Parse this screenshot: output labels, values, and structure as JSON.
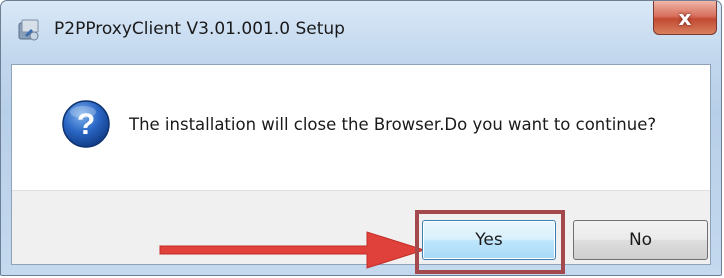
{
  "window": {
    "title": "P2PProxyClient V3.01.001.0 Setup",
    "close_glyph": "x"
  },
  "message": {
    "text": "The installation will close the Browser.Do you want to continue?",
    "icon": "question-icon"
  },
  "buttons": {
    "yes_label": "Yes",
    "no_label": "No"
  },
  "annotation": {
    "arrow_color": "#e0413a",
    "highlight_color": "#a3484c"
  }
}
